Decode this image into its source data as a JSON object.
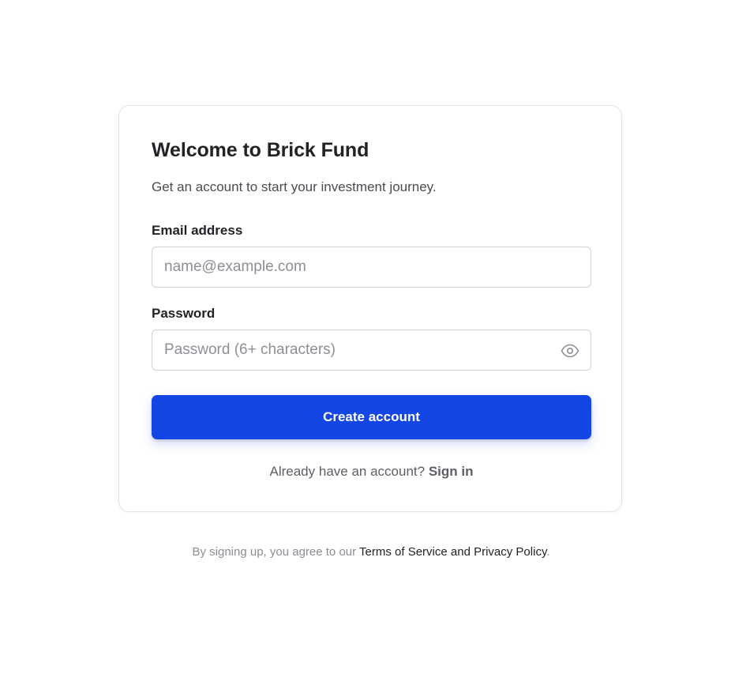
{
  "card": {
    "title": "Welcome to Brick Fund",
    "subtitle": "Get an account to start your investment journey."
  },
  "form": {
    "email": {
      "label": "Email address",
      "value": "",
      "placeholder": "name@example.com"
    },
    "password": {
      "label": "Password",
      "value": "",
      "placeholder": "Password (6+ characters)",
      "toggle_icon": "eye-icon"
    },
    "submit_label": "Create account"
  },
  "signin": {
    "prompt": "Already have an account?",
    "link_label": "Sign in"
  },
  "footer": {
    "prefix": "By signing up, you agree to our",
    "link_label": "Terms of Service and Privacy Policy",
    "suffix": "."
  },
  "colors": {
    "accent": "#1446e6",
    "border": "#cfd2d8",
    "text": "#222326",
    "muted": "#8a8d93"
  }
}
